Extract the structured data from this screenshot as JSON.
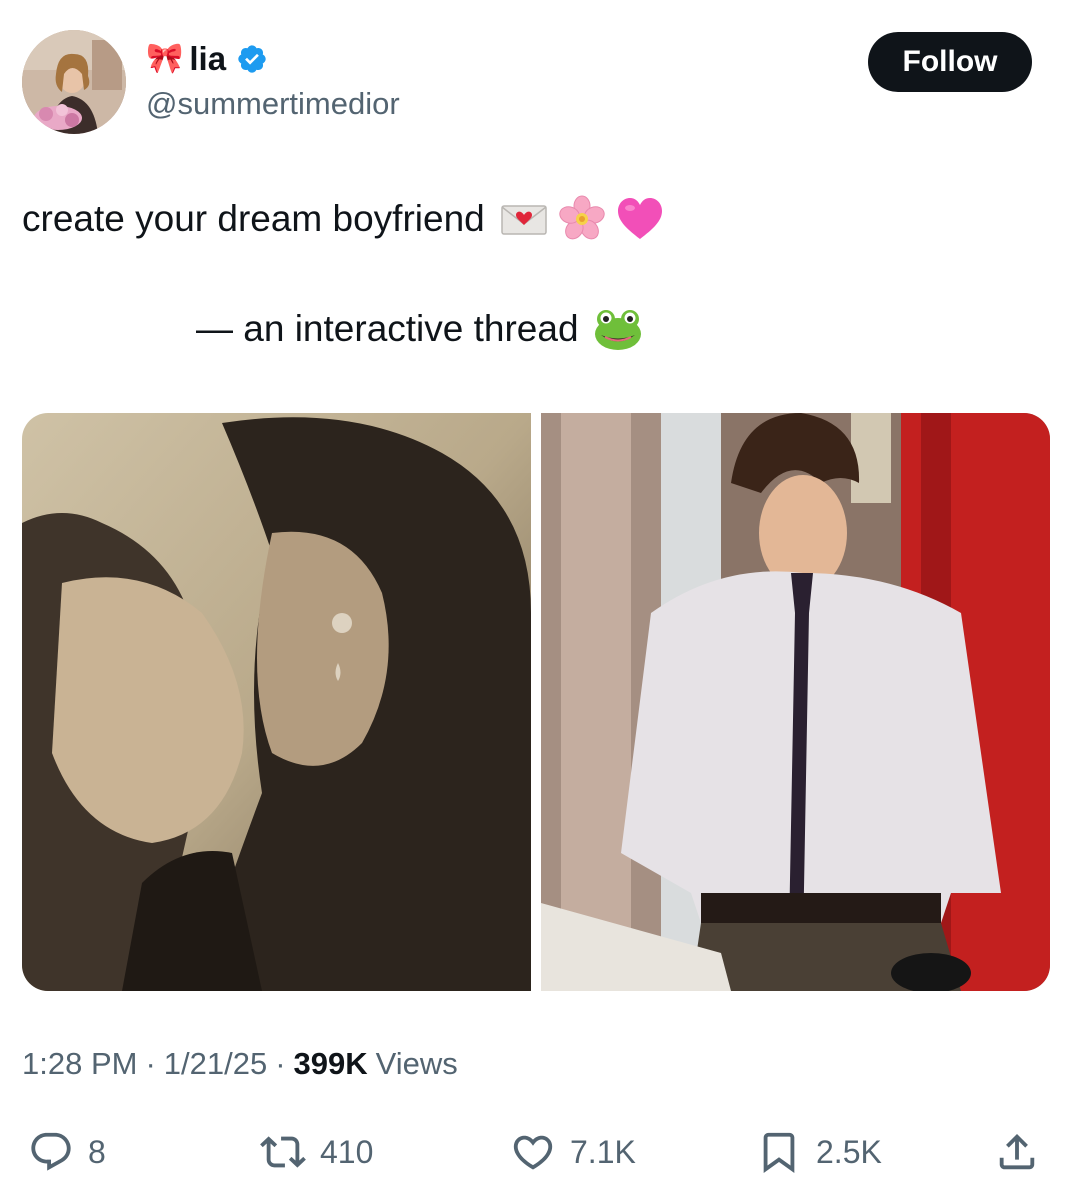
{
  "author": {
    "bow_glyph": "🎀",
    "display_name": "lia",
    "handle": "@summertimedior",
    "verified_icon": "verified-badge-icon",
    "verified_color": "#1d9bf0"
  },
  "follow_label": "Follow",
  "tweet": {
    "line1": "create your dream boyfriend",
    "line1_emojis": [
      "love-letter-emoji",
      "cherry-blossom-emoji",
      "pink-heart-emoji"
    ],
    "line2": "— an interactive thread",
    "line2_emojis": [
      "frog-emoji"
    ]
  },
  "media": [
    {
      "icon": "photo-couple-kissing-sepia"
    },
    {
      "icon": "photo-man-striped-shirt-tie"
    }
  ],
  "meta": {
    "time": "1:28 PM",
    "date": "1/21/25",
    "views_count": "399K",
    "views_label": "Views"
  },
  "actions": {
    "reply_count": "8",
    "retweet_count": "410",
    "like_count": "7.1K",
    "bookmark_count": "2.5K"
  },
  "colors": {
    "text": "#0f1419",
    "secondary": "#536471",
    "follow_bg": "#0f1419",
    "verified": "#1d9bf0"
  }
}
